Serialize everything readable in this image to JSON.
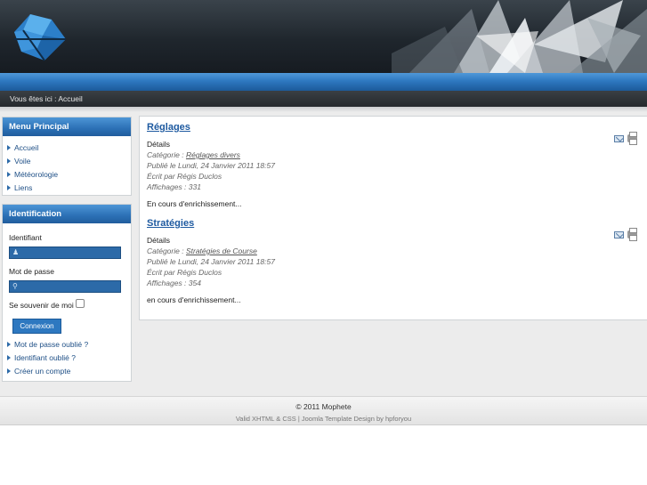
{
  "breadcrumb": {
    "prefix": "Vous êtes ici :",
    "current": "Accueil"
  },
  "menu": {
    "title": "Menu Principal",
    "items": [
      {
        "label": "Accueil"
      },
      {
        "label": "Voile"
      },
      {
        "label": "Météorologie"
      },
      {
        "label": "Liens"
      }
    ]
  },
  "login": {
    "title": "Identification",
    "username_label": "Identifiant",
    "password_label": "Mot de passe",
    "remember_label": "Se souvenir de moi",
    "remember_checked": false,
    "submit_label": "Connexion",
    "links": [
      {
        "label": "Mot de passe oublié ?"
      },
      {
        "label": "Identifiant oublié ?"
      },
      {
        "label": "Créer un compte"
      }
    ]
  },
  "articles": [
    {
      "title": "Réglages",
      "details": "Détails",
      "category_prefix": "Catégorie :",
      "category": "Réglages divers",
      "published": "Publié le Lundi, 24 Janvier 2011 18:57",
      "author": "Écrit par Régis Duclos",
      "hits": "Affichages : 331",
      "body": "En cours d'enrichissement..."
    },
    {
      "title": "Stratégies",
      "details": "Détails",
      "category_prefix": "Catégorie :",
      "category": "Stratégies de Course",
      "published": "Publié le Lundi, 24 Janvier 2011 18:57",
      "author": "Écrit par Régis Duclos",
      "hits": "Affichages : 354",
      "body": "en cours d'enrichissement..."
    }
  ],
  "footer": {
    "copyright": "© 2011 Mophete",
    "credit": "Valid XHTML & CSS | Joomla Template Design by hpforyou"
  },
  "icons": {
    "logo": "blue-diamond-logo-icon",
    "email": "email-icon",
    "print": "print-icon",
    "user": "user-icon",
    "key": "key-icon",
    "bullet": "arrow-right-icon"
  },
  "colors": {
    "accent_blue": "#2e78c0",
    "header_dark": "#1f262d",
    "link": "#1e5aa0"
  }
}
